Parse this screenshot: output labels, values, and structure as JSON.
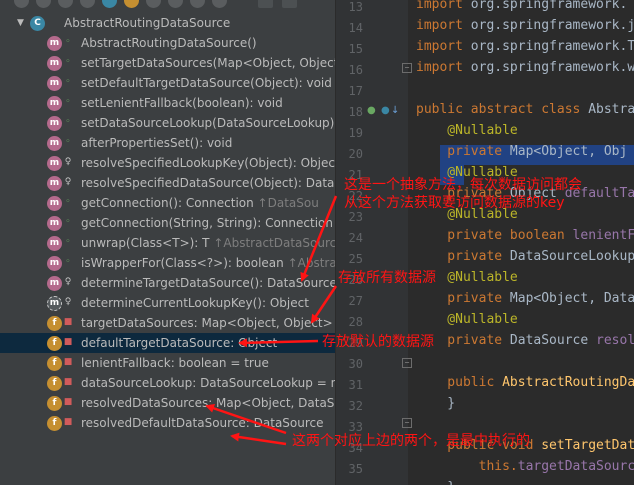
{
  "structure_tree": {
    "root": {
      "label": "AbstractRoutingDataSource"
    },
    "members": [
      {
        "icon": "m",
        "vis": "public",
        "label": "AbstractRoutingDataSource()",
        "suffix": ""
      },
      {
        "icon": "m",
        "vis": "public",
        "label": "setTargetDataSources(Map<Object, Object",
        "suffix": ""
      },
      {
        "icon": "m",
        "vis": "public",
        "label": "setDefaultTargetDataSource(Object): void",
        "suffix": ""
      },
      {
        "icon": "m",
        "vis": "public",
        "label": "setLenientFallback(boolean): void",
        "suffix": ""
      },
      {
        "icon": "m",
        "vis": "public",
        "label": "setDataSourceLookup(DataSourceLookup):",
        "suffix": ""
      },
      {
        "icon": "m",
        "vis": "public",
        "label": "afterPropertiesSet(): void",
        "suffix": ""
      },
      {
        "icon": "m",
        "vis": "protected",
        "label": "resolveSpecifiedLookupKey(Object): Object",
        "suffix": ""
      },
      {
        "icon": "m",
        "vis": "protected",
        "label": "resolveSpecifiedDataSource(Object): DataSo",
        "suffix": ""
      },
      {
        "icon": "m",
        "vis": "public",
        "label": "getConnection(): Connection ",
        "suffix": "↑DataSou"
      },
      {
        "icon": "m",
        "vis": "public",
        "label": "getConnection(String, String): Connection ",
        "suffix": "↑"
      },
      {
        "icon": "m",
        "vis": "public",
        "label": "unwrap(Class<T>): T ",
        "suffix": "↑AbstractDataSource"
      },
      {
        "icon": "m",
        "vis": "public",
        "label": "isWrapperFor(Class<?>): boolean ",
        "suffix": "↑Abstrac"
      },
      {
        "icon": "m",
        "vis": "protected",
        "label": "determineTargetDataSource(): DataSource",
        "suffix": ""
      },
      {
        "icon": "m-abstract",
        "vis": "protected",
        "label": "determineCurrentLookupKey(): Object",
        "suffix": ""
      },
      {
        "icon": "f",
        "vis": "private",
        "label": "targetDataSources: Map<Object, Object>",
        "suffix": ""
      },
      {
        "icon": "f",
        "vis": "private",
        "label": "defaultTargetDataSource: Object",
        "suffix": ""
      },
      {
        "icon": "f",
        "vis": "private",
        "label": "lenientFallback: boolean = true",
        "suffix": ""
      },
      {
        "icon": "f",
        "vis": "private",
        "label": "dataSourceLookup: DataSourceLookup = n",
        "suffix": ""
      },
      {
        "icon": "f",
        "vis": "private",
        "label": "resolvedDataSources: Map<Object, DataSo",
        "suffix": ""
      },
      {
        "icon": "f",
        "vis": "private",
        "label": "resolvedDefaultDataSource: DataSource",
        "suffix": ""
      }
    ]
  },
  "editor": {
    "line_numbers": [
      "13",
      "14",
      "15",
      "16",
      "17",
      "18",
      "19",
      "20",
      "21",
      "22",
      "23",
      "24",
      "25",
      "26",
      "27",
      "28",
      "29",
      "30",
      "31",
      "32",
      "33",
      "34",
      "35"
    ],
    "lines": [
      [
        {
          "t": "import ",
          "c": "kw"
        },
        {
          "t": "org.springframework.",
          "c": ""
        }
      ],
      [
        {
          "t": "import ",
          "c": "kw"
        },
        {
          "t": "org.springframework.j",
          "c": ""
        }
      ],
      [
        {
          "t": "import ",
          "c": "kw"
        },
        {
          "t": "org.springframework.T",
          "c": ""
        }
      ],
      [
        {
          "t": "import ",
          "c": "kw"
        },
        {
          "t": "org.springframework.w",
          "c": ""
        }
      ],
      [],
      [
        {
          "t": "public abstract class ",
          "c": "kw"
        },
        {
          "t": "Abstra",
          "c": ""
        }
      ],
      [
        {
          "t": "    @Nullable",
          "c": "an"
        }
      ],
      [
        {
          "t": "    private ",
          "c": "kw"
        },
        {
          "t": "Map<Object, Obj",
          "c": ""
        }
      ],
      [
        {
          "t": "    @Nullable",
          "c": "an"
        }
      ],
      [
        {
          "t": "    private ",
          "c": "kw"
        },
        {
          "t": "Object ",
          "c": ""
        },
        {
          "t": "defaultTa",
          "c": "fd"
        }
      ],
      [
        {
          "t": "    @Nullable",
          "c": "an"
        }
      ],
      [
        {
          "t": "    private boolean ",
          "c": "kw"
        },
        {
          "t": "lenientF",
          "c": "fd"
        }
      ],
      [
        {
          "t": "    private ",
          "c": "kw"
        },
        {
          "t": "DataSourceLookup",
          "c": ""
        }
      ],
      [
        {
          "t": "    @Nullable",
          "c": "an"
        }
      ],
      [
        {
          "t": "    private ",
          "c": "kw"
        },
        {
          "t": "Map<Object, Data",
          "c": ""
        }
      ],
      [
        {
          "t": "    @Nullable",
          "c": "an"
        }
      ],
      [
        {
          "t": "    private ",
          "c": "kw"
        },
        {
          "t": "DataSource ",
          "c": ""
        },
        {
          "t": "resol",
          "c": "fd"
        }
      ],
      [],
      [
        {
          "t": "    public ",
          "c": "kw"
        },
        {
          "t": "AbstractRoutingDat",
          "c": "fn"
        }
      ],
      [
        {
          "t": "    }",
          "c": ""
        }
      ],
      [],
      [
        {
          "t": "    public void ",
          "c": "kw"
        },
        {
          "t": "setTargetDat",
          "c": "fn"
        }
      ],
      [
        {
          "t": "        this.",
          "c": "kw"
        },
        {
          "t": "targetDataSourc",
          "c": "fd"
        }
      ],
      [
        {
          "t": "    }",
          "c": ""
        }
      ]
    ]
  },
  "annotations": {
    "note1_line1": "这是一个抽象方法，每次数据访问都会",
    "note1_line2": "从这个方法获取要访问数据源的key",
    "note2": "存放所有数据源",
    "note3": "存放默认的数据源",
    "note4": "这两个对应上边的两个，是最中执行的"
  },
  "colors": {
    "annotation": "#ff1414",
    "selection": "#0d293e",
    "code_highlight": "#214283"
  }
}
